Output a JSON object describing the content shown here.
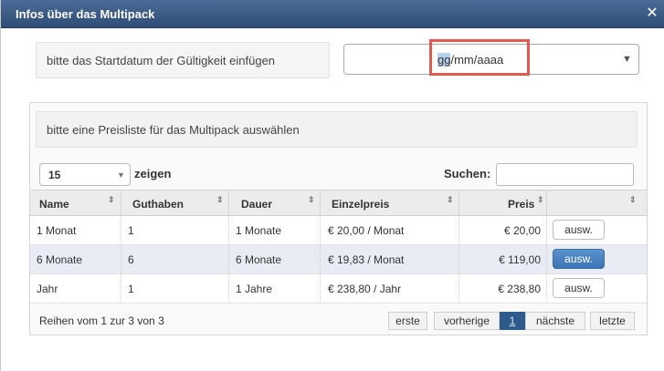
{
  "dialog": {
    "title": "Infos über das Multipack",
    "close_symbol": "✕"
  },
  "start_date": {
    "label": "bitte das Startdatum der Gültigkeit einfügen",
    "value_selected": "gg",
    "value_rest": "/mm/aaaa",
    "arrow": "▼"
  },
  "pricelist": {
    "label": "bitte eine Preisliste für das Multipack auswählen",
    "length_value": "15",
    "length_arrow": "▼",
    "length_suffix": "zeigen",
    "search_label": "Suchen:",
    "search_value": "",
    "columns": [
      "Name",
      "Guthaben",
      "Dauer",
      "Einzelpreis",
      "Preis",
      ""
    ],
    "sort_icon": "⇕",
    "rows": [
      {
        "name": "1 Monat",
        "guthaben": "1",
        "dauer": "1 Monate",
        "einzelpreis": "€ 20,00 / Monat",
        "preis": "€ 20,00",
        "action": "ausw."
      },
      {
        "name": "6 Monate",
        "guthaben": "6",
        "dauer": "6 Monate",
        "einzelpreis": "€ 19,83 / Monat",
        "preis": "€ 119,00",
        "action": "ausw."
      },
      {
        "name": "Jahr",
        "guthaben": "1",
        "dauer": "1 Jahre",
        "einzelpreis": "€ 238,80 / Jahr",
        "preis": "€ 238,80",
        "action": "ausw."
      }
    ],
    "info": "Reihen vom 1 zur 3 von 3",
    "pager": {
      "first": "erste",
      "prev": "vorherige",
      "current": "1",
      "next": "nächste",
      "last": "letzte"
    }
  },
  "colors": {
    "titlebar": "#2e4d77",
    "active_button": "#3c74b5",
    "highlight_box": "#e25a4f"
  }
}
